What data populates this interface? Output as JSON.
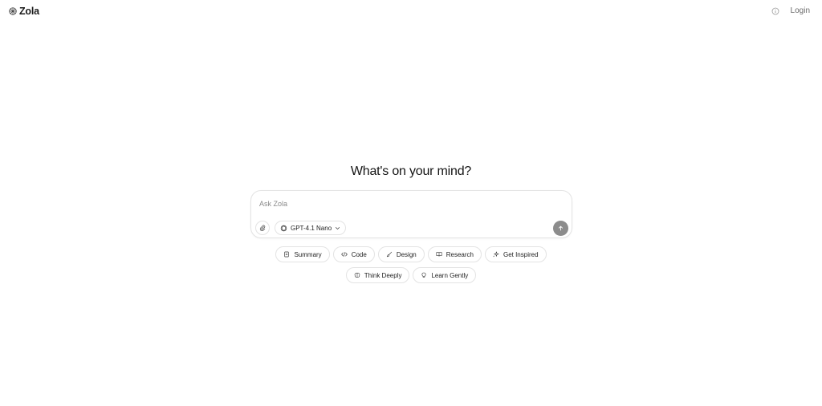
{
  "header": {
    "brand": "Zola",
    "login_label": "Login",
    "icons": {
      "logo": "zola-logo-icon",
      "info": "info-icon"
    }
  },
  "main": {
    "headline": "What's on your mind?"
  },
  "composer": {
    "placeholder": "Ask Zola",
    "value": "",
    "model_label": "GPT-4.1 Nano",
    "icons": {
      "attach": "paperclip-icon",
      "model": "openai-icon",
      "dropdown": "chevron-down-icon",
      "send": "arrow-up-icon"
    },
    "send_button_color": "#8c8c8c"
  },
  "suggestions": [
    {
      "label": "Summary",
      "icon": "document-icon"
    },
    {
      "label": "Code",
      "icon": "code-icon"
    },
    {
      "label": "Design",
      "icon": "brush-icon"
    },
    {
      "label": "Research",
      "icon": "book-icon"
    },
    {
      "label": "Get Inspired",
      "icon": "sparkle-icon"
    },
    {
      "label": "Think Deeply",
      "icon": "brain-icon"
    },
    {
      "label": "Learn Gently",
      "icon": "lightbulb-icon"
    }
  ]
}
